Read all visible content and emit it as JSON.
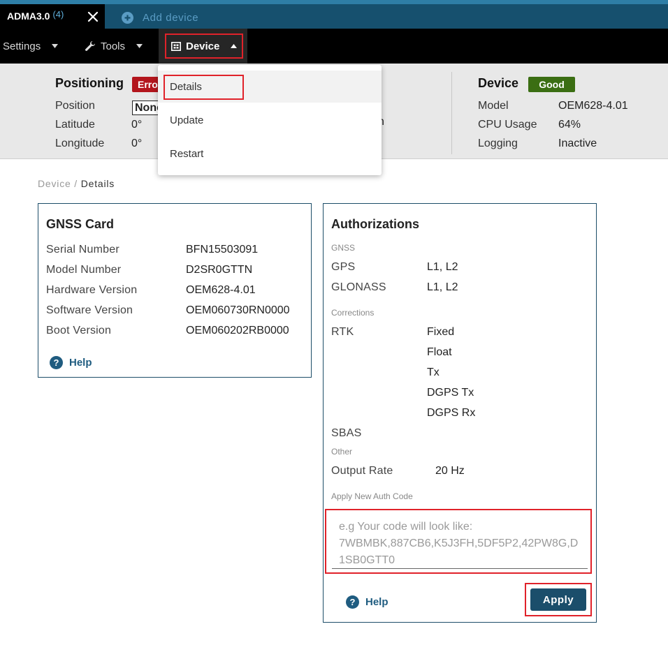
{
  "tabs": {
    "active_title": "ADMA3.0",
    "active_count": "(4)",
    "add_label": "Add device"
  },
  "menubar": {
    "settings": "Settings",
    "tools": "Tools",
    "device": "Device"
  },
  "dropdown": {
    "items": [
      "Details",
      "Update",
      "Restart"
    ]
  },
  "status": {
    "positioning": {
      "title": "Positioning",
      "badge": "Error",
      "labels": [
        "Position",
        "Latitude",
        "Longitude"
      ],
      "position_value": "None",
      "latitude_value": "0°",
      "longitude_value": "0°",
      "hidden_tail": "n"
    },
    "device": {
      "title": "Device",
      "badge": "Good",
      "labels": [
        "Model",
        "CPU Usage",
        "Logging"
      ],
      "values": [
        "OEM628-4.01",
        "64%",
        "Inactive"
      ]
    }
  },
  "breadcrumb": {
    "parent": "Device",
    "sep": "/",
    "current": "Details"
  },
  "gnss_card": {
    "title": "GNSS Card",
    "rows": [
      {
        "label": "Serial Number",
        "value": "BFN15503091"
      },
      {
        "label": "Model Number",
        "value": "D2SR0GTTN"
      },
      {
        "label": "Hardware Version",
        "value": "OEM628-4.01"
      },
      {
        "label": "Software Version",
        "value": "OEM060730RN0000"
      },
      {
        "label": "Boot Version",
        "value": "OEM060202RB0000"
      }
    ],
    "help": "Help"
  },
  "auth_card": {
    "title": "Authorizations",
    "gnss_section": "GNSS",
    "gps_label": "GPS",
    "gps_value": "L1, L2",
    "glonass_label": "GLONASS",
    "glonass_value": "L1, L2",
    "corrections_section": "Corrections",
    "rtk_label": "RTK",
    "rtk_values": [
      "Fixed",
      "Float",
      "Tx",
      "DGPS Tx",
      "DGPS Rx"
    ],
    "sbas_label": "SBAS",
    "other_section": "Other",
    "output_rate_label": "Output Rate",
    "output_rate_value": "20 Hz",
    "apply_code_section": "Apply New Auth Code",
    "code_value": "",
    "code_placeholder": "e.g Your code will look like: 7WBMBK,887CB6,K5J3FH,5DF5P2,42PW8G,D1SB0GTT0",
    "help": "Help",
    "apply": "Apply"
  },
  "colors": {
    "tab_bar": "#16506e",
    "accent_top": "#2e7ea6",
    "error": "#b3151c",
    "good": "#3b6e13",
    "highlight": "#e0222a",
    "primary_button": "#1b4e6b"
  },
  "icons": [
    "close-icon",
    "plus-circle-icon",
    "chevron-down-icon",
    "wrench-icon",
    "device-chip-icon",
    "chevron-up-icon",
    "help-icon"
  ]
}
